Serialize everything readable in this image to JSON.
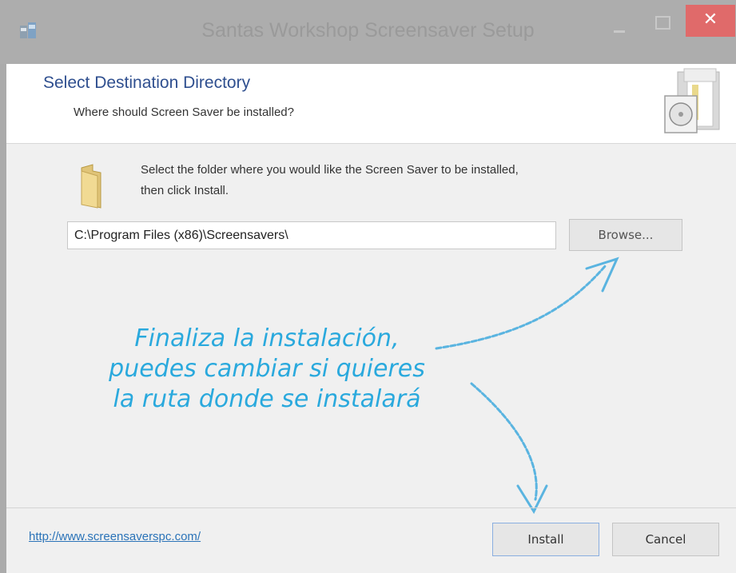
{
  "window": {
    "title": "Santas Workshop Screensaver Setup",
    "close_glyph": "✕",
    "colors": {
      "titlebar": "#adadad",
      "close_button": "#e06a6a",
      "accent_text": "#2f4f8f",
      "annotation": "#2aa9dd"
    }
  },
  "header": {
    "title": "Select Destination Directory",
    "subtitle": "Where should Screen Saver be installed?"
  },
  "body": {
    "description_line1": "Select the folder where you would like the Screen Saver to be installed,",
    "description_line2": "then click Install.",
    "path_value": "C:\\Program Files (x86)\\Screensavers\\",
    "browse_label": "Browse..."
  },
  "annotation": {
    "line1": "Finaliza la instalación,",
    "line2": "puedes cambiar si quieres",
    "line3": "la ruta donde se instalará"
  },
  "footer": {
    "link": "http://www.screensaverspc.com/",
    "install_label": "Install",
    "cancel_label": "Cancel"
  },
  "icons": [
    "installer-app-icon",
    "minimize-icon",
    "maximize-icon",
    "close-icon",
    "installer-box-icon",
    "folder-icon"
  ]
}
